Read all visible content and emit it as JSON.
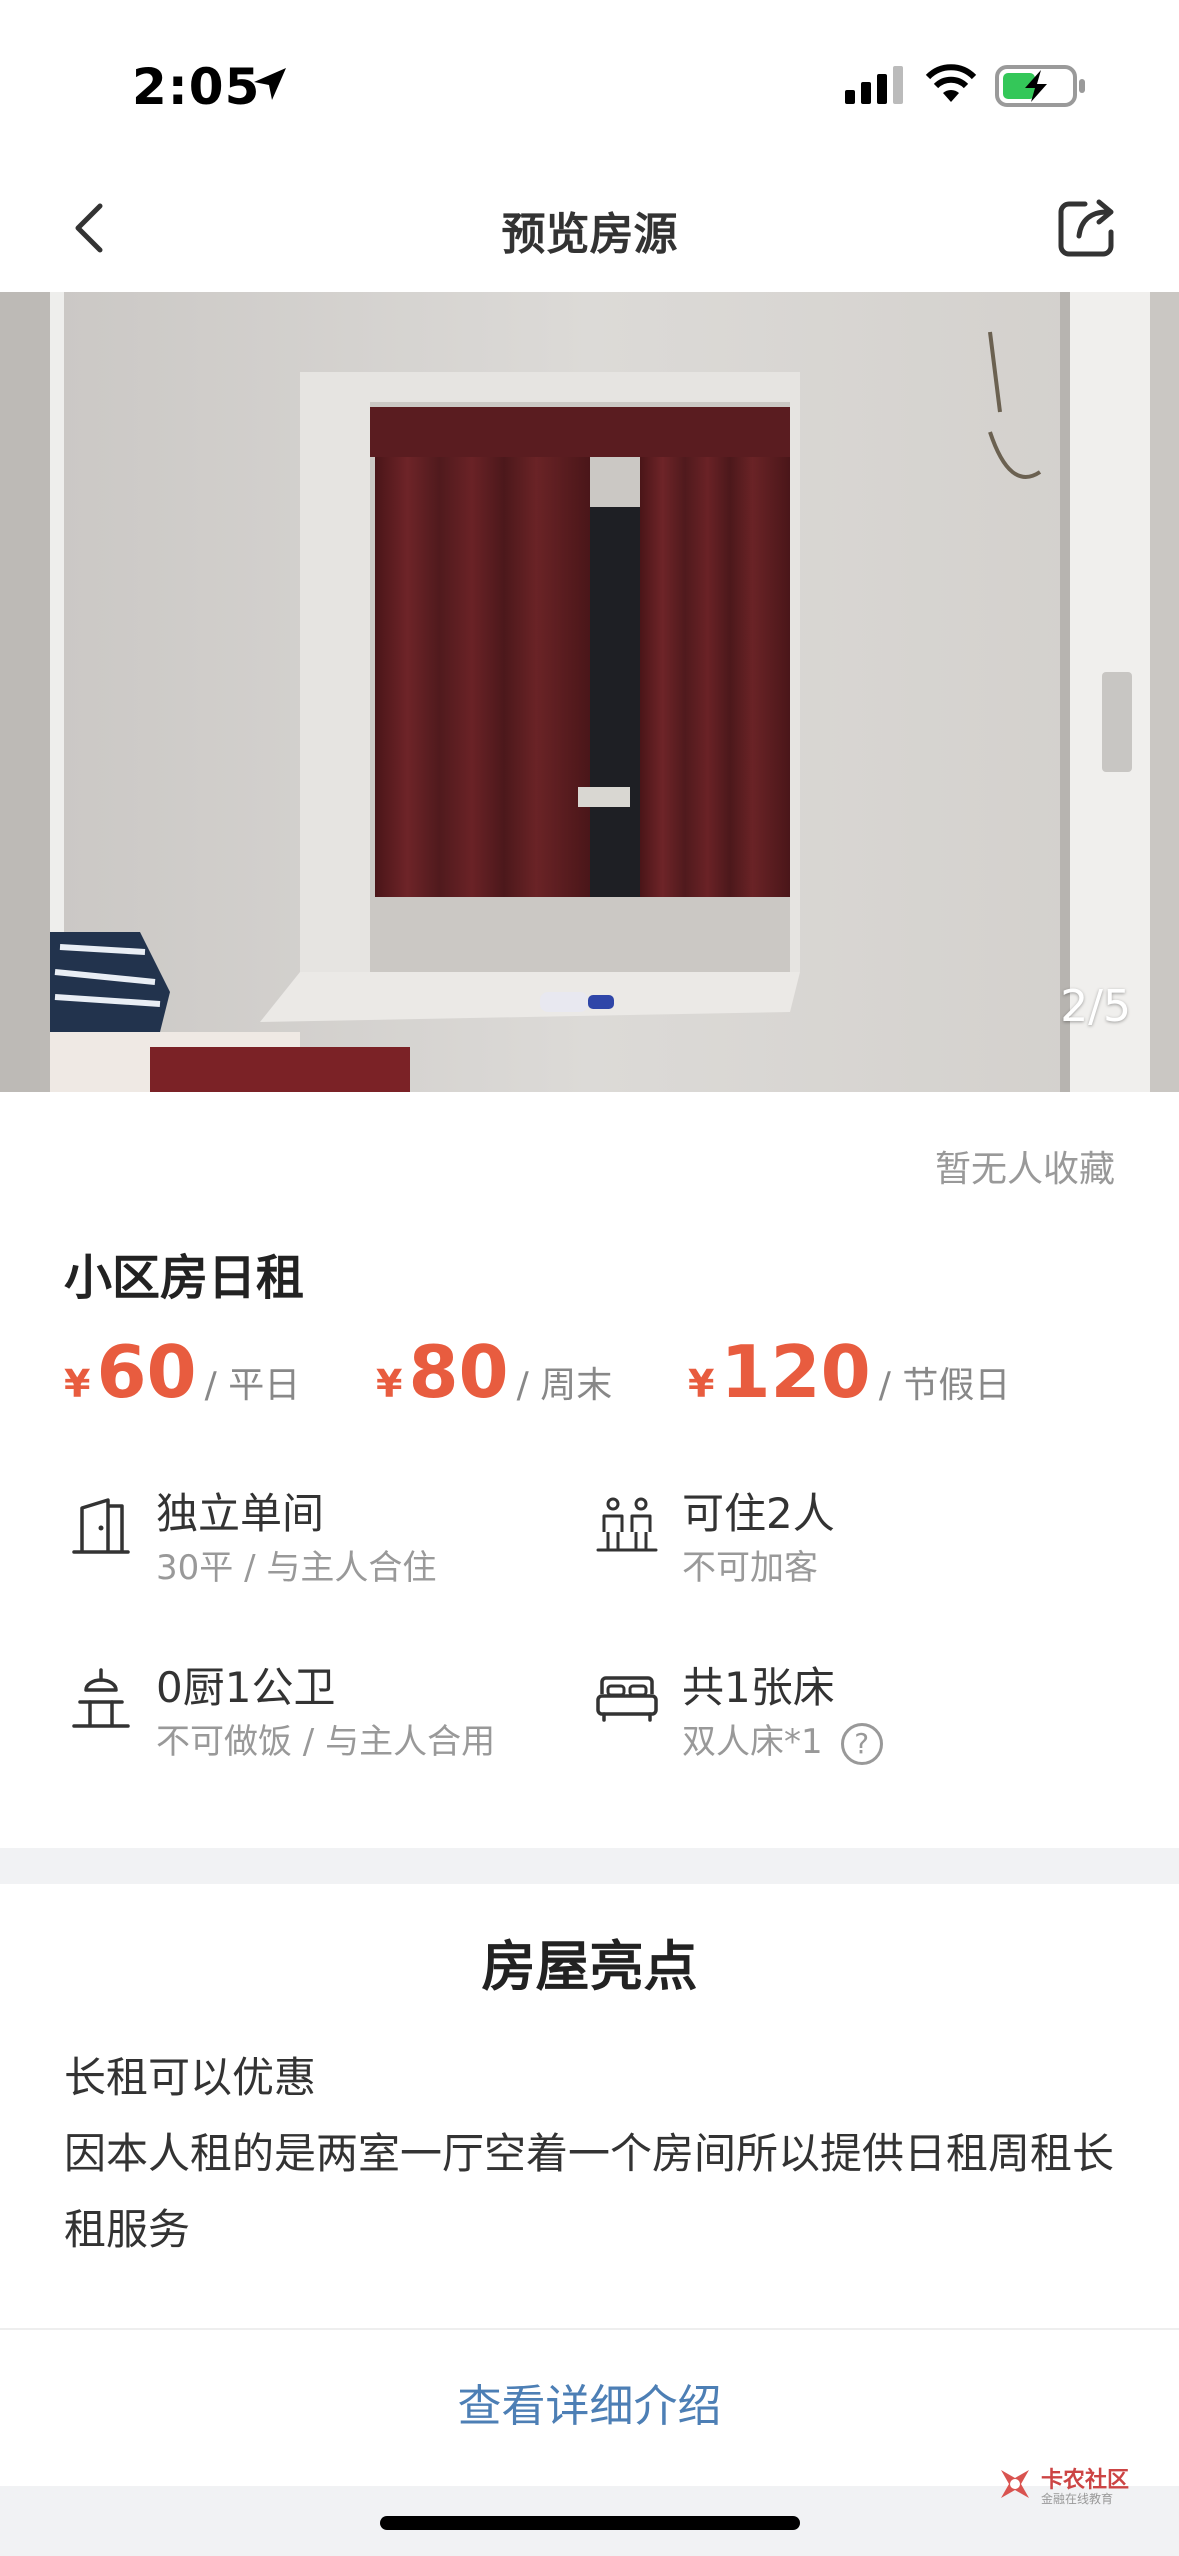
{
  "status_bar": {
    "time": "2:05"
  },
  "nav": {
    "title": "预览房源"
  },
  "photo": {
    "counter": "2/5"
  },
  "favorites": "暂无人收藏",
  "listing_name": "小区房日租",
  "currency": "¥",
  "prices": [
    {
      "value": "60",
      "unit": "/ 平日"
    },
    {
      "value": "80",
      "unit": "/ 周末"
    },
    {
      "value": "120",
      "unit": "/ 节假日"
    }
  ],
  "features": {
    "room": {
      "title": "独立单间",
      "detail": "30平 / 与主人合住",
      "icon": "door-icon"
    },
    "guests": {
      "title": "可住2人",
      "detail": "不可加客",
      "icon": "people-icon"
    },
    "kitchen_bath": {
      "title": "0厨1公卫",
      "detail": "不可做饭 / 与主人合用",
      "icon": "shower-icon"
    },
    "beds": {
      "title": "共1张床",
      "detail": "双人床*1",
      "icon": "bed-icon",
      "help": "?"
    }
  },
  "highlights": {
    "title": "房屋亮点",
    "lines": [
      "长租可以优惠",
      "因本人租的是两室一厅空着一个房间所以提供日租周租长租服务"
    ]
  },
  "more_link": "查看详细介绍",
  "watermark": {
    "title": "卡农社区",
    "subtitle": "金融在线教育"
  },
  "colors": {
    "price": "#e85c3f",
    "link": "#4d7fb5",
    "separator": "#f1f2f4"
  }
}
